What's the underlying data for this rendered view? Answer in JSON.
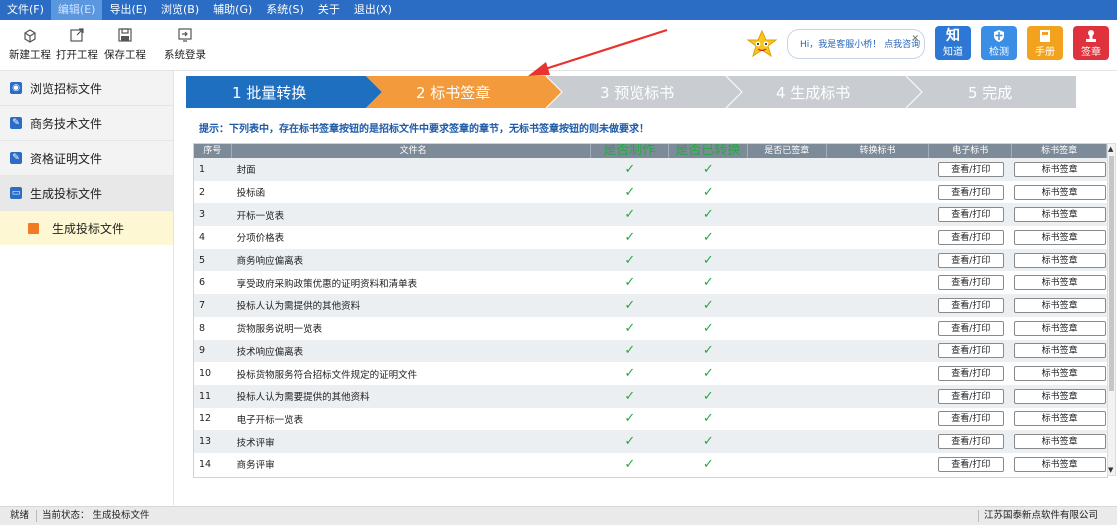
{
  "menu": {
    "items": [
      "文件(F)",
      "编辑(E)",
      "导出(E)",
      "浏览(B)",
      "辅助(G)",
      "系统(S)",
      "关于",
      "退出(X)"
    ]
  },
  "toolbar": {
    "new_project": "新建工程",
    "open_project": "打开工程",
    "save_project": "保存工程",
    "system_login": "系统登录",
    "assistant_text": "Hi，我是客服小桥！ 点我咨询",
    "zhi_glyph": "知",
    "zhi_label": "知道",
    "check_label": "检测",
    "manual_label": "手册",
    "sign_label": "签章",
    "colors": {
      "zhi": "#2c78d4",
      "check": "#3a8ee6",
      "manual": "#f2a21c",
      "sign": "#e0323c"
    }
  },
  "sidebar": {
    "items": [
      {
        "label": "浏览招标文件",
        "icon": "eye-icon"
      },
      {
        "label": "商务技术文件",
        "icon": "pencil-icon"
      },
      {
        "label": "资格证明文件",
        "icon": "pencil-icon"
      },
      {
        "label": "生成投标文件",
        "icon": "document-icon"
      }
    ],
    "sub_item": "生成投标文件"
  },
  "steps": [
    {
      "label": "1 批量转换",
      "state": "done"
    },
    {
      "label": "2 标书签章",
      "state": "current"
    },
    {
      "label": "3 预览标书",
      "state": "pending"
    },
    {
      "label": "4 生成标书",
      "state": "pending"
    },
    {
      "label": "5 完成",
      "state": "pending"
    }
  ],
  "tip": "提示：下列表中，存在标书签章按钮的是招标文件中要求签章的章节，无标书签章按钮的则未做要求！",
  "table": {
    "headers": [
      "序号",
      "文件名",
      "是否制作",
      "是否已转换",
      "是否已签章",
      "转换标书",
      "电子标书",
      "标书签章"
    ],
    "view_button": "查看/打印",
    "sign_button": "标书签章",
    "check_mark": "✓",
    "rows": [
      {
        "no": "1",
        "name": "封面"
      },
      {
        "no": "2",
        "name": "投标函"
      },
      {
        "no": "3",
        "name": "开标一览表"
      },
      {
        "no": "4",
        "name": "分项价格表"
      },
      {
        "no": "5",
        "name": "商务响应偏离表"
      },
      {
        "no": "6",
        "name": "享受政府采购政策优惠的证明资料和清单表"
      },
      {
        "no": "7",
        "name": "投标人认为需提供的其他资料"
      },
      {
        "no": "8",
        "name": "货物服务说明一览表"
      },
      {
        "no": "9",
        "name": "技术响应偏离表"
      },
      {
        "no": "10",
        "name": "投标货物服务符合招标文件规定的证明文件"
      },
      {
        "no": "11",
        "name": "投标人认为需要提供的其他资料"
      },
      {
        "no": "12",
        "name": "电子开标一览表"
      },
      {
        "no": "13",
        "name": "技术评审"
      },
      {
        "no": "14",
        "name": "商务评审"
      }
    ]
  },
  "status": {
    "ready": "就绪",
    "current_state": "当前状态： 生成投标文件",
    "company": "江苏国泰新点软件有限公司"
  }
}
